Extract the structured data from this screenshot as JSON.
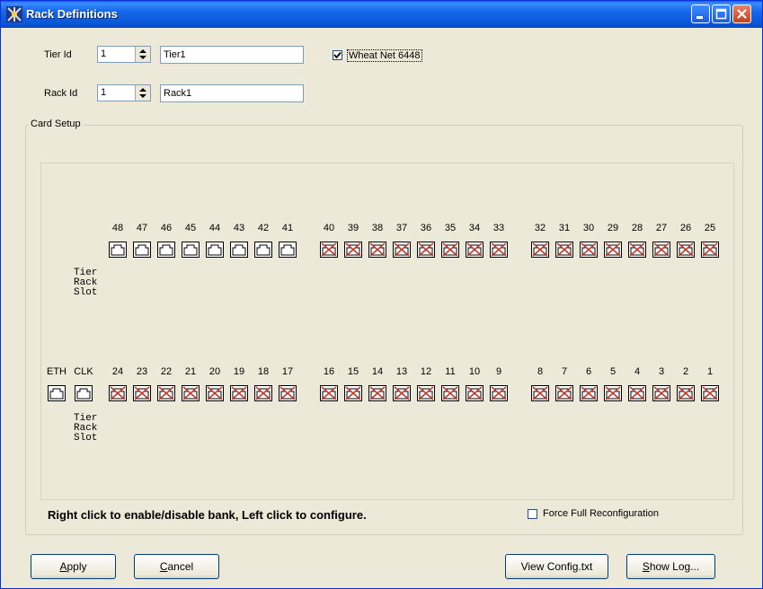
{
  "window": {
    "title": "Rack Definitions"
  },
  "tier": {
    "label": "Tier Id",
    "spin_value": "1",
    "name": "Tier1"
  },
  "rack": {
    "label": "Rack Id",
    "spin_value": "1",
    "name": "Rack1"
  },
  "wheatnet": {
    "label": "Wheat Net 6448",
    "checked": true
  },
  "card_setup": {
    "title": "Card Setup",
    "top_row": {
      "ports": [
        {
          "num": "48",
          "enabled": true
        },
        {
          "num": "47",
          "enabled": true
        },
        {
          "num": "46",
          "enabled": true
        },
        {
          "num": "45",
          "enabled": true
        },
        {
          "num": "44",
          "enabled": true
        },
        {
          "num": "43",
          "enabled": true
        },
        {
          "num": "42",
          "enabled": true
        },
        {
          "num": "41",
          "enabled": true
        },
        {
          "num": "40",
          "enabled": false
        },
        {
          "num": "39",
          "enabled": false
        },
        {
          "num": "38",
          "enabled": false
        },
        {
          "num": "37",
          "enabled": false
        },
        {
          "num": "36",
          "enabled": false
        },
        {
          "num": "35",
          "enabled": false
        },
        {
          "num": "34",
          "enabled": false
        },
        {
          "num": "33",
          "enabled": false
        },
        {
          "num": "32",
          "enabled": false
        },
        {
          "num": "31",
          "enabled": false
        },
        {
          "num": "30",
          "enabled": false
        },
        {
          "num": "29",
          "enabled": false
        },
        {
          "num": "28",
          "enabled": false
        },
        {
          "num": "27",
          "enabled": false
        },
        {
          "num": "26",
          "enabled": false
        },
        {
          "num": "25",
          "enabled": false
        }
      ],
      "info_lines": [
        "Tier",
        "Rack",
        "Slot"
      ]
    },
    "bottom_row": {
      "special": [
        {
          "num": "ETH",
          "enabled": true
        },
        {
          "num": "CLK",
          "enabled": true
        }
      ],
      "ports": [
        {
          "num": "24",
          "enabled": false
        },
        {
          "num": "23",
          "enabled": false
        },
        {
          "num": "22",
          "enabled": false
        },
        {
          "num": "21",
          "enabled": false
        },
        {
          "num": "20",
          "enabled": false
        },
        {
          "num": "19",
          "enabled": false
        },
        {
          "num": "18",
          "enabled": false
        },
        {
          "num": "17",
          "enabled": false
        },
        {
          "num": "16",
          "enabled": false
        },
        {
          "num": "15",
          "enabled": false
        },
        {
          "num": "14",
          "enabled": false
        },
        {
          "num": "13",
          "enabled": false
        },
        {
          "num": "12",
          "enabled": false
        },
        {
          "num": "11",
          "enabled": false
        },
        {
          "num": "10",
          "enabled": false
        },
        {
          "num": "9",
          "enabled": false
        },
        {
          "num": "8",
          "enabled": false
        },
        {
          "num": "7",
          "enabled": false
        },
        {
          "num": "6",
          "enabled": false
        },
        {
          "num": "5",
          "enabled": false
        },
        {
          "num": "4",
          "enabled": false
        },
        {
          "num": "3",
          "enabled": false
        },
        {
          "num": "2",
          "enabled": false
        },
        {
          "num": "1",
          "enabled": false
        }
      ],
      "info_lines": [
        "Tier",
        "Rack",
        "Slot"
      ]
    },
    "hint": "Right click to enable/disable bank, Left click to configure.",
    "force_full": {
      "label": "Force Full Reconfiguration",
      "checked": false
    }
  },
  "buttons": {
    "apply": {
      "mnemonic": "A",
      "rest": "pply"
    },
    "cancel": {
      "mnemonic": "C",
      "rest": "ancel"
    },
    "view_config": "View Config.txt",
    "show_log": {
      "mnemonic": "S",
      "rest": "how Log..."
    }
  },
  "colors": {
    "titlebar": "#0a5ee8",
    "port_disabled_x": "#c0392b",
    "face": "#ece9d8"
  }
}
